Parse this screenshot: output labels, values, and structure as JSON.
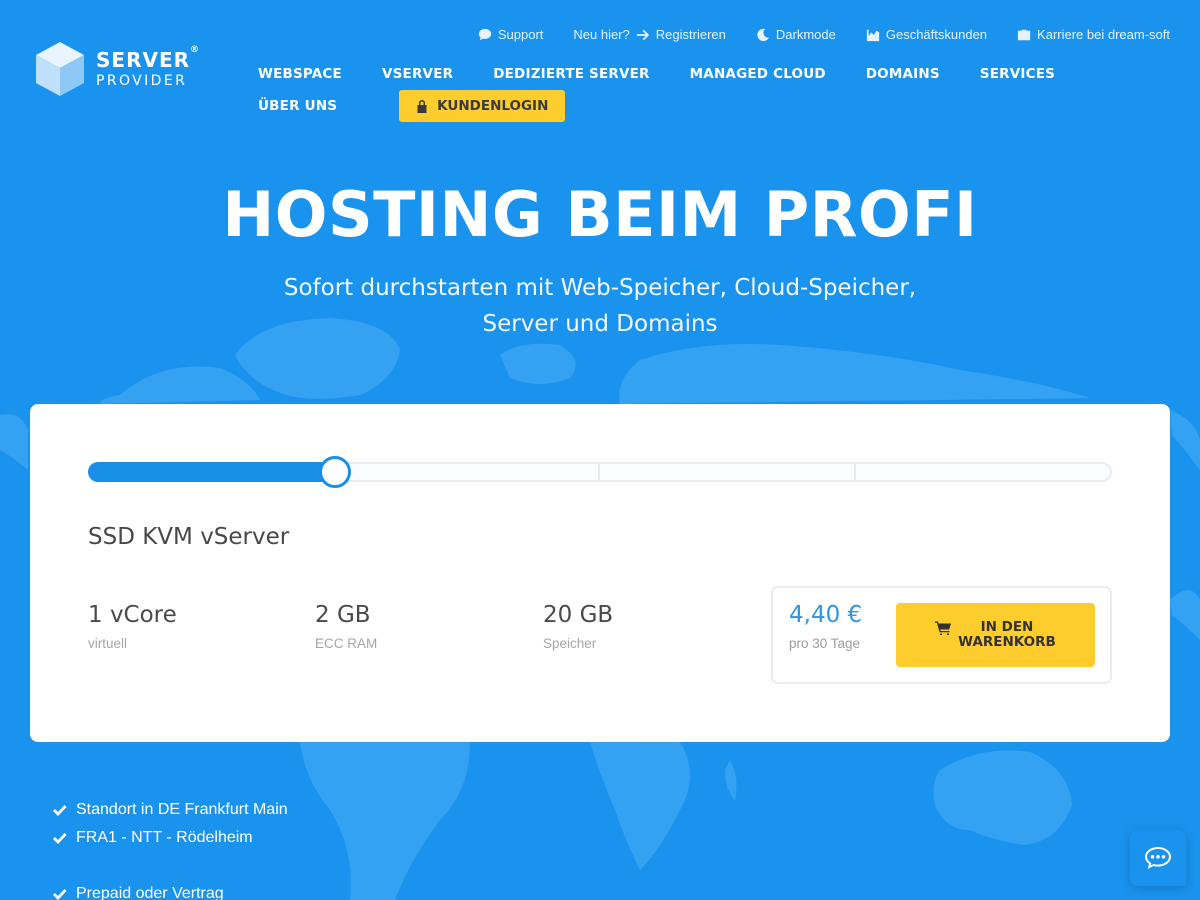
{
  "brand": {
    "line1": "SERVER",
    "line2": "PROVIDER",
    "reg": "®"
  },
  "topbar": {
    "support": "Support",
    "new_here": "Neu hier?",
    "register": "Registrieren",
    "darkmode": "Darkmode",
    "business": "Geschäftskunden",
    "career": "Karriere bei dream-soft"
  },
  "nav": {
    "items": [
      "WEBSPACE",
      "VSERVER",
      "DEDIZIERTE SERVER",
      "MANAGED CLOUD",
      "DOMAINS",
      "SERVICES",
      "ÜBER UNS"
    ],
    "login": "KUNDENLOGIN"
  },
  "hero": {
    "title": "HOSTING BEIM PROFI",
    "subtitle_1": "Sofort durchstarten mit Web-Speicher, Cloud-Speicher,",
    "subtitle_2": "Server und Domains"
  },
  "configurator": {
    "slider_fraction": 0.24,
    "slider_steps": 4,
    "product": "SSD KVM vServer",
    "specs": [
      {
        "value": "1 vCore",
        "unit": "virtuell"
      },
      {
        "value": "2 GB",
        "unit": "ECC RAM"
      },
      {
        "value": "20 GB",
        "unit": "Speicher"
      }
    ],
    "price": "4,40 €",
    "period": "pro 30 Tage",
    "cart_line1": "IN DEN",
    "cart_line2": "WARENKORB"
  },
  "features": [
    "Standort in DE Frankfurt Main",
    "FRA1 - NTT - Rödelheim",
    "Prepaid oder Vertrag"
  ],
  "colors": {
    "background": "#1a93ee",
    "accent": "#fdcd2d",
    "slider": "#1a8fe8",
    "price": "#2e95e5"
  },
  "icons": [
    "cube-logo-icon",
    "chat-bubble-icon",
    "arrow-right-icon",
    "moon-icon",
    "chart-icon",
    "briefcase-icon",
    "lock-icon",
    "cart-icon",
    "check-icon",
    "chat-widget-icon"
  ]
}
